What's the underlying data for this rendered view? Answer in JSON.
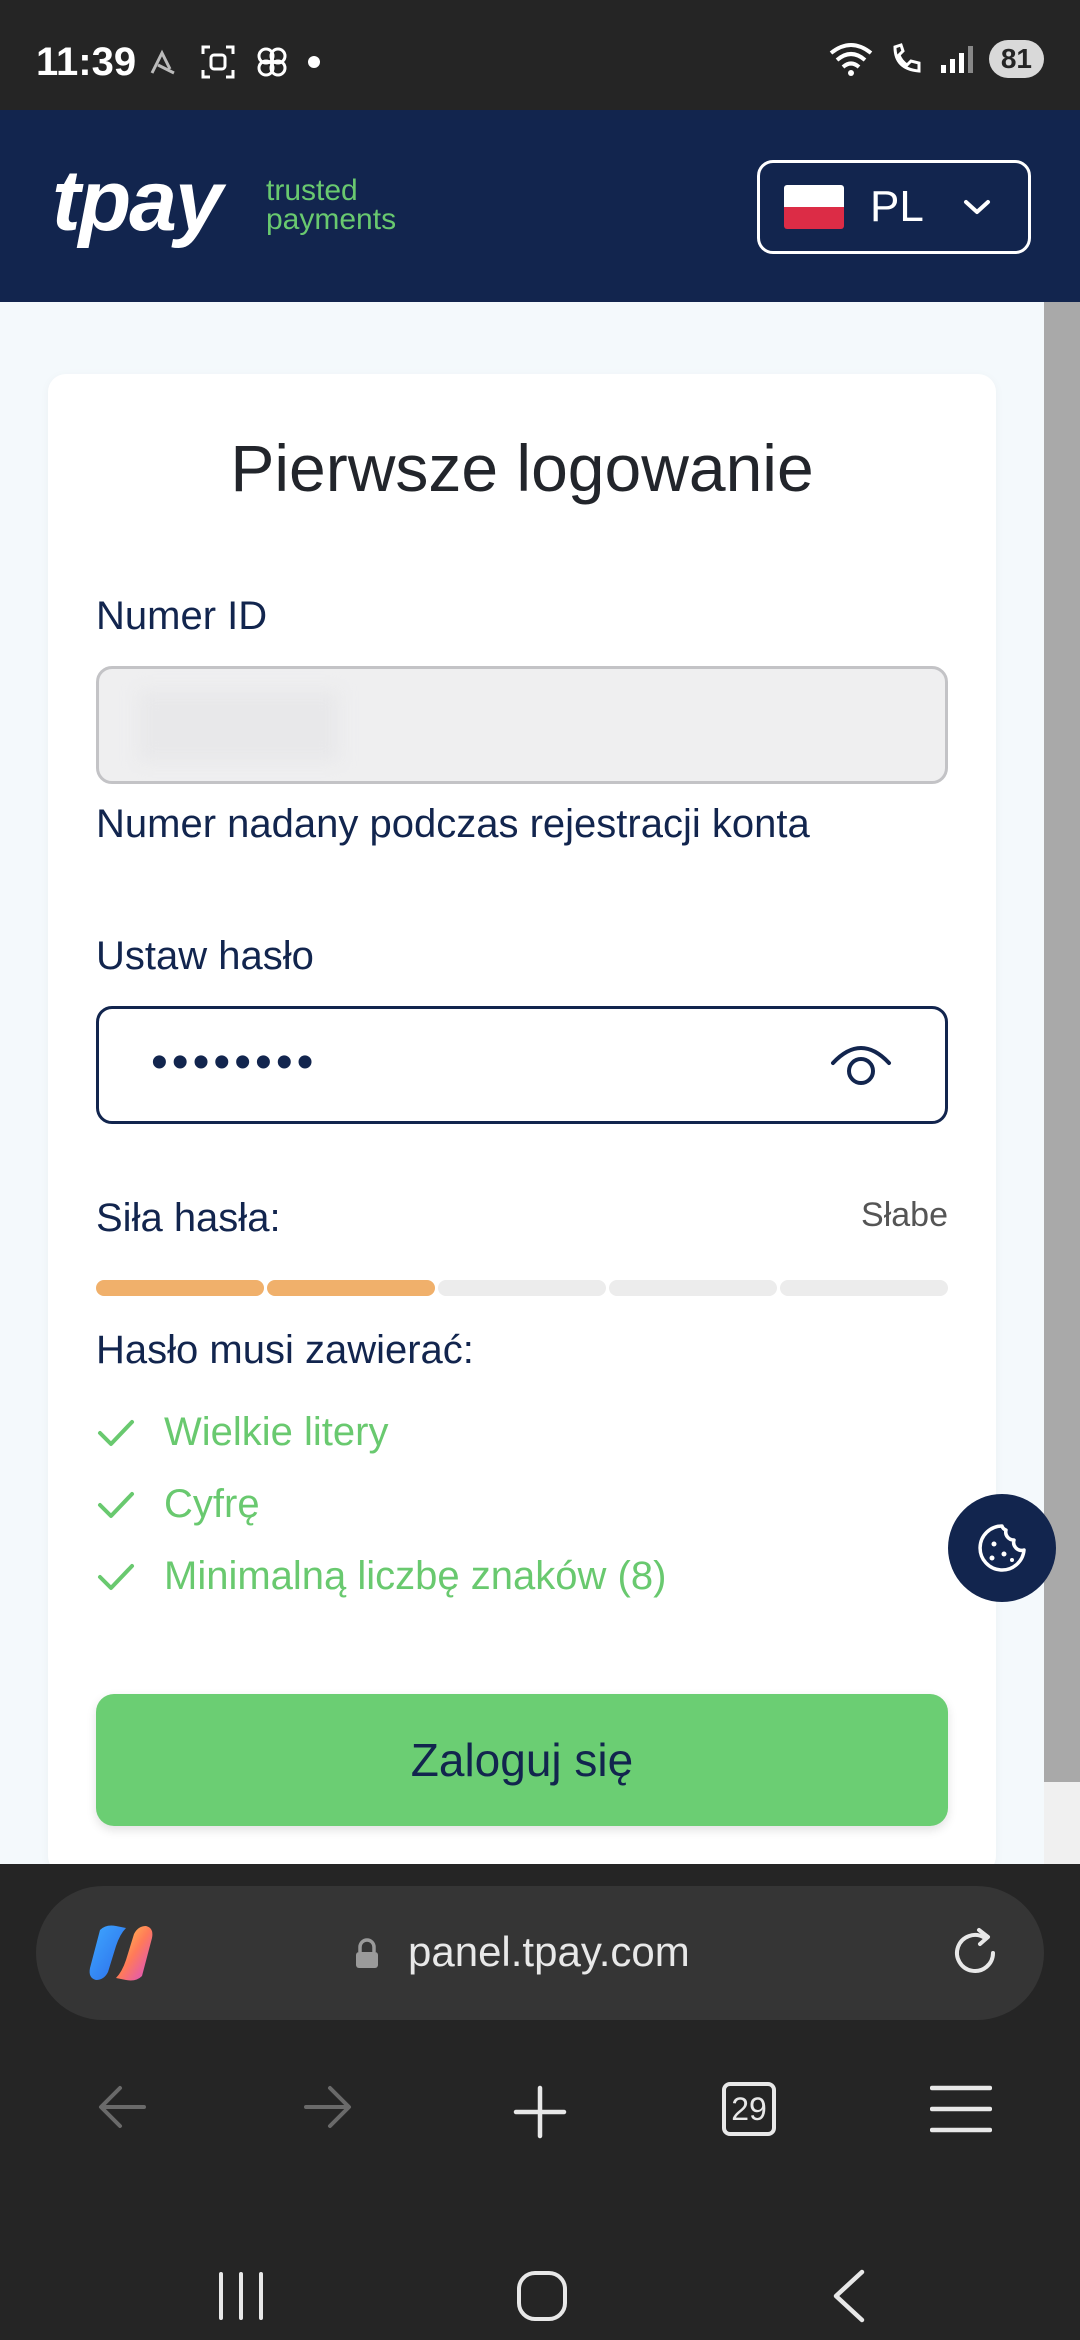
{
  "status_bar": {
    "time": "11:39",
    "battery": "81"
  },
  "header": {
    "logo": "tpay",
    "tagline_line1": "trusted",
    "tagline_line2": "payments",
    "language": "PL"
  },
  "form": {
    "title": "Pierwsze logowanie",
    "id_label": "Numer ID",
    "id_value": "",
    "id_helper": "Numer nadany podczas rejestracji konta",
    "password_label": "Ustaw hasło",
    "password_masked": "••••••••",
    "strength_label": "Siła hasła:",
    "strength_value": "Słabe",
    "strength_level": 2,
    "strength_segments": 5,
    "requirements_title": "Hasło musi zawierać:",
    "requirements": [
      {
        "text": "Wielkie litery",
        "met": true
      },
      {
        "text": "Cyfrę",
        "met": true
      },
      {
        "text": "Minimalną liczbę znaków (8)",
        "met": true
      }
    ],
    "submit_label": "Zaloguj się"
  },
  "browser": {
    "url": "panel.tpay.com",
    "tab_count": "29"
  },
  "colors": {
    "header_bg": "#12254e",
    "accent_green": "#6bce73",
    "strength_orange": "#f0b06b"
  }
}
